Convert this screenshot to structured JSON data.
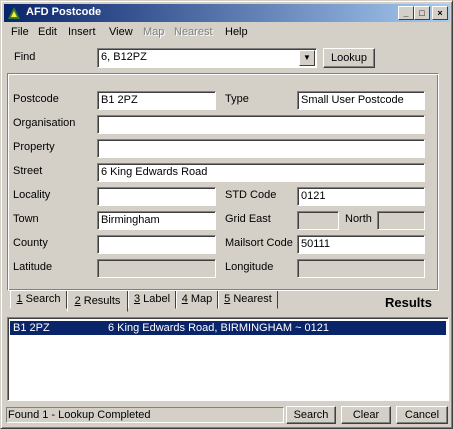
{
  "window": {
    "title": "AFD Postcode"
  },
  "menu": [
    "File",
    "Edit",
    "Insert",
    "View",
    "Map",
    "Nearest",
    "Help"
  ],
  "find": {
    "label": "Find",
    "value": "6, B12PZ",
    "lookup_button": "Lookup"
  },
  "fields": {
    "postcode": {
      "label": "Postcode",
      "value": "B1 2PZ"
    },
    "type": {
      "label": "Type",
      "value": "Small User Postcode"
    },
    "organisation": {
      "label": "Organisation",
      "value": ""
    },
    "property": {
      "label": "Property",
      "value": ""
    },
    "street": {
      "label": "Street",
      "value": "6 King Edwards Road"
    },
    "locality": {
      "label": "Locality",
      "value": ""
    },
    "std_code": {
      "label": "STD Code",
      "value": "0121"
    },
    "town": {
      "label": "Town",
      "value": "Birmingham"
    },
    "grid_east": {
      "label": "Grid East",
      "value": ""
    },
    "north": {
      "label": "North",
      "value": ""
    },
    "county": {
      "label": "County",
      "value": ""
    },
    "mailsort": {
      "label": "Mailsort Code",
      "value": "50111"
    },
    "latitude": {
      "label": "Latitude",
      "value": ""
    },
    "longitude": {
      "label": "Longitude",
      "value": ""
    }
  },
  "tabs": [
    {
      "num": "1",
      "label": "Search"
    },
    {
      "num": "2",
      "label": "Results"
    },
    {
      "num": "3",
      "label": "Label"
    },
    {
      "num": "4",
      "label": "Map"
    },
    {
      "num": "5",
      "label": "Nearest"
    }
  ],
  "results": {
    "title": "Results",
    "rows": [
      {
        "postcode": "B1 2PZ",
        "address": "6 King Edwards Road, BIRMINGHAM ~ 0121"
      }
    ]
  },
  "status": "Found 1 - Lookup Completed",
  "buttons": {
    "search": "Search",
    "clear": "Clear",
    "cancel": "Cancel"
  }
}
